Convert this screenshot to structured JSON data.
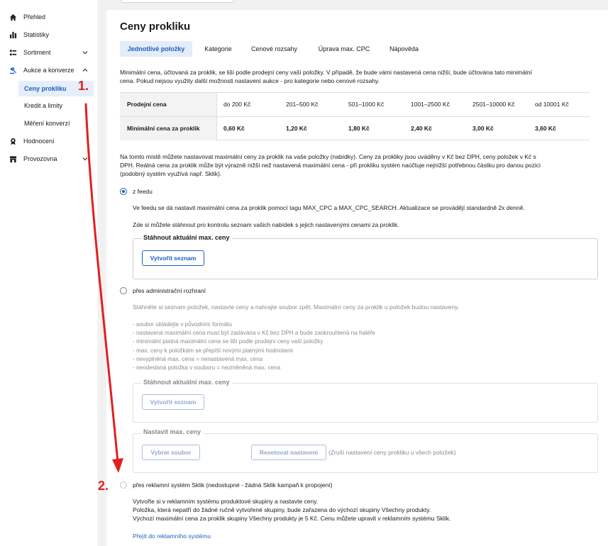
{
  "sidebar": {
    "items": [
      {
        "label": "Přehled",
        "icon": "home-icon"
      },
      {
        "label": "Statistiky",
        "icon": "bar-chart-icon"
      },
      {
        "label": "Sortiment",
        "icon": "list-icon"
      },
      {
        "label": "Aukce a konverze",
        "icon": "auction-icon"
      },
      {
        "label": "Hodnocení",
        "icon": "rating-icon"
      },
      {
        "label": "Provozovna",
        "icon": "store-icon"
      }
    ],
    "subitems": [
      "Ceny prokliku",
      "Kredit a limity",
      "Měření konverzí"
    ]
  },
  "page": {
    "title": "Ceny prokliku",
    "tabs": [
      "Jednotlivé položky",
      "Kategorie",
      "Cenové rozsahy",
      "Úprava max. CPC",
      "Nápověda"
    ],
    "intro_1": "Minimální cena, účtovaná za proklik, se liší podle prodejní ceny vaší položky. V případě, že bude vámi nastavená cena nižší, bude účtována tato minimální",
    "intro_2": "cena. Pokud nejsou využity další možnosti nastavení aukce - pro kategorie nebo cenové rozsahy."
  },
  "price_table": {
    "row1_header": "Prodejní cena",
    "row2_header": "Minimální cena za proklik",
    "ranges": [
      "do 200 Kč",
      "201–500 Kč",
      "501–1000 Kč",
      "1001–2500 Kč",
      "2501–10000 Kč",
      "od 10001 Kč"
    ],
    "prices": [
      "0,60 Kč",
      "1,20 Kč",
      "1,80 Kč",
      "2,40 Kč",
      "3,00 Kč",
      "3,60 Kč"
    ]
  },
  "info": {
    "line1": "Na tomto místě můžete nastavovat maximální ceny za proklik na vaše položky (nabídky). Ceny za prokliky jsou uváděny v Kč bez DPH, ceny položek v Kč s",
    "line2": "DPH. Reálná cena za proklik může být výrazně nižší než nastavená maximální cena - při prokliku systém naúčtuje nejnižší potřebnou částku pro danou pozici",
    "line3": "(podobný systém využívá např. Sklik)."
  },
  "option_feed": {
    "label": "z feedu",
    "desc": "Ve feedu se dá nastavit maximální cena za proklik pomocí tagu MAX_CPC a MAX_CPC_SEARCH. Aktualizace se provádějí standardně 2x denně.",
    "download_text": "Zde si můžete stáhnout pro kontrolu seznam vašich nabídek s jejich nastavenými cenami za proklik.",
    "legend": "Stáhnout aktuální max. ceny",
    "button": "Vytvořit seznam"
  },
  "option_admin": {
    "label": "přes administrační rozhraní",
    "desc": "Stáhněte si seznam položek, nastavte ceny a nahrajte soubor zpět. Maximální ceny za proklik u položek budou nastaveny.",
    "notes": [
      "- soubor ukládejte v původním formátu",
      "- nastavená maximální cena musí být zadávána v Kč bez DPH a bude zaokrouhlená na haléře",
      "- minimální platná maximální cena se liší podle prodejní ceny vaší položky",
      "- max. ceny k položkám se přepíší novými platnými hodnotami",
      "- nevyplněná max. cena = nenastavená max. cena",
      "- neodeslaná položka v souboru = nezměněná max. cena"
    ],
    "legend_download": "Stáhnout aktuální max. ceny",
    "button_create": "Vytvořit seznam",
    "legend_set": "Nastavit max. ceny",
    "button_choose": "Vybrat soubor",
    "button_reset": "Resetovat nastavení",
    "reset_note": "(Zruší nastavení ceny prokliku u všech položek)"
  },
  "option_sklik": {
    "label": "přes reklamní systém Sklik (nedostupné - žádná Sklik kampaň k propojení)",
    "desc": [
      "Vytvořte si v reklamním systému produktové skupiny a nastavte ceny.",
      "Položka, která nepatří do žádné ručně vytvořené skupiny, bude zařazena do výchozí skupiny Všechny produkty.",
      "Výchozí maximální cena za proklik skupiny Všechny produkty je 5 Kč. Cenu můžete upravit v reklamním systému Sklik."
    ],
    "link": "Přejít do reklamního systému"
  },
  "annotations": {
    "step1": "1.",
    "step2": "2.",
    "color": "#e02020"
  }
}
